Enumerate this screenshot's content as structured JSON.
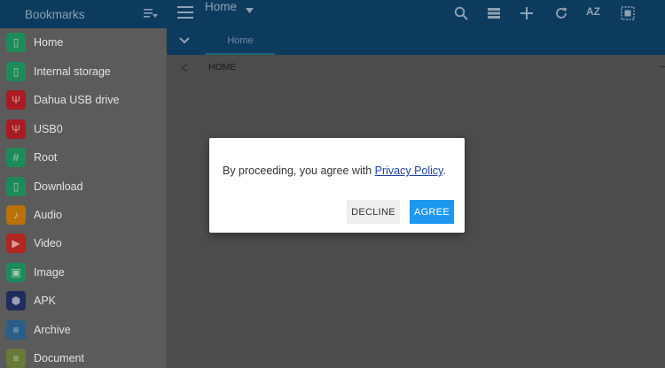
{
  "sidebar": {
    "title": "Bookmarks",
    "items": [
      {
        "label": "Home",
        "icon": "home-icon",
        "color": "#1e8a5a"
      },
      {
        "label": "Internal storage",
        "icon": "phone-icon",
        "color": "#1e8a5a"
      },
      {
        "label": "Dahua USB drive",
        "icon": "usb-icon",
        "color": "#a81c24"
      },
      {
        "label": "USB0",
        "icon": "usb-icon",
        "color": "#a81c24"
      },
      {
        "label": "Root",
        "icon": "hash-icon",
        "color": "#1e8a5a"
      },
      {
        "label": "Download",
        "icon": "download-icon",
        "color": "#1e8a5a"
      },
      {
        "label": "Audio",
        "icon": "music-note-icon",
        "color": "#b8720a"
      },
      {
        "label": "Video",
        "icon": "play-icon",
        "color": "#b02621"
      },
      {
        "label": "Image",
        "icon": "image-icon",
        "color": "#1e8a5a"
      },
      {
        "label": "APK",
        "icon": "android-icon",
        "color": "#1f2c5e"
      },
      {
        "label": "Archive",
        "icon": "archive-icon",
        "color": "#2a5d8a"
      },
      {
        "label": "Document",
        "icon": "document-icon",
        "color": "#6a7a3a"
      }
    ]
  },
  "topbar": {
    "title": "Home",
    "sort_label": "AZ"
  },
  "tabs": {
    "active_label": "Home"
  },
  "path": {
    "label": "HOME"
  },
  "dialog": {
    "message_prefix": "By proceeding, you agree with ",
    "link_text": "Privacy Policy",
    "message_suffix": ".",
    "decline_label": "DECLINE",
    "agree_label": "AGREE"
  },
  "colors": {
    "appbar": "#0d3b5e",
    "accent": "#1e97f0",
    "link": "#1a3fa8"
  }
}
